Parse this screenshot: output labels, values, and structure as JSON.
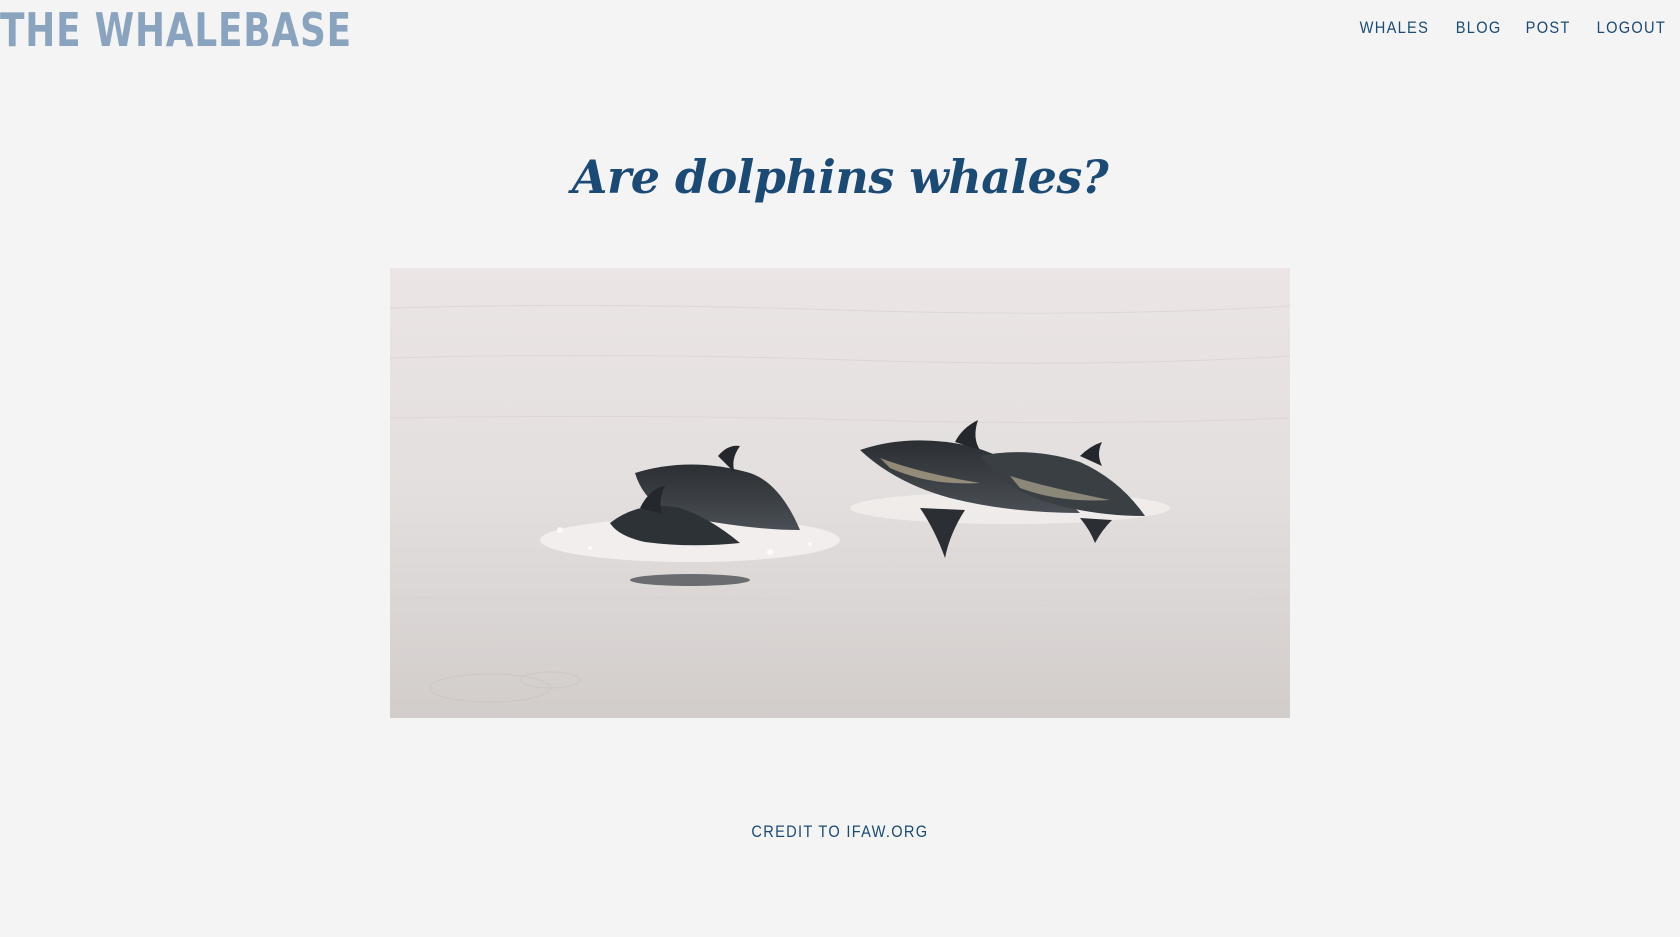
{
  "header": {
    "logo_text": "THE WHALEBASE",
    "nav": [
      {
        "label": "WHALES"
      },
      {
        "label": "BLOG"
      },
      {
        "label": "POST"
      },
      {
        "label": "LOGOUT"
      }
    ]
  },
  "post": {
    "title": "Are dolphins whales?",
    "image_subject": "dolphins-swimming-photo",
    "credit": "CREDIT TO IFAW.ORG"
  },
  "colors": {
    "background": "#f4f4f4",
    "accent": "#1b4a75",
    "logo": "#8aa4bf"
  }
}
